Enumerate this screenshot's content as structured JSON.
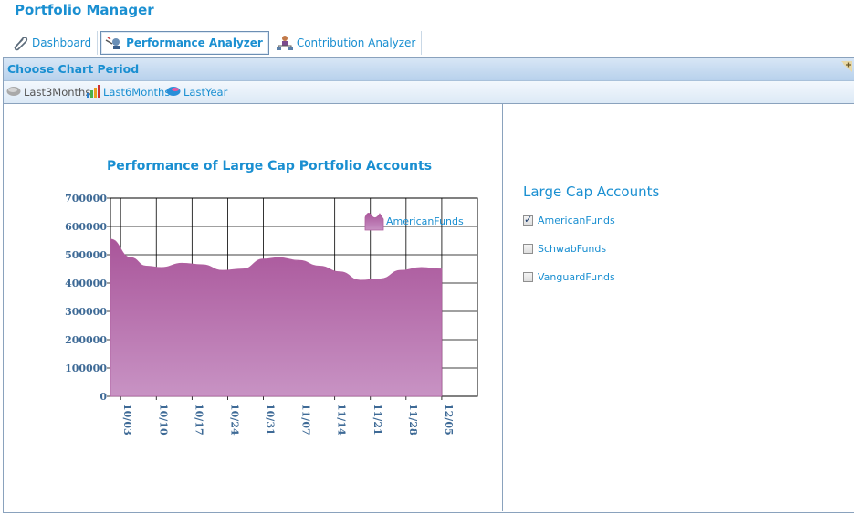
{
  "app": {
    "title": "Portfolio Manager"
  },
  "tabs": [
    {
      "label": "Dashboard",
      "icon": "paperclip-icon",
      "active": false
    },
    {
      "label": "Performance Analyzer",
      "icon": "analyzer-icon",
      "active": true
    },
    {
      "label": "Contribution Analyzer",
      "icon": "org-chart-icon",
      "active": false
    }
  ],
  "panel": {
    "title": "Choose Chart Period"
  },
  "toolbar": [
    {
      "label": "Last3Months",
      "icon": "gray-pill-icon",
      "color": "#555555"
    },
    {
      "label": "Last6Months",
      "icon": "bar-chart-icon",
      "color": "#1a8fd1"
    },
    {
      "label": "LastYear",
      "icon": "blue-pill-icon",
      "color": "#1a8fd1"
    }
  ],
  "chart_data": {
    "type": "area",
    "title": "Performance of Large Cap Portfolio Accounts",
    "xlabel": "",
    "ylabel": "",
    "ylim": [
      0,
      700000
    ],
    "yticks": [
      0,
      100000,
      200000,
      300000,
      400000,
      500000,
      600000,
      700000
    ],
    "ytick_labels": [
      "0",
      "100000",
      "200000",
      "300000",
      "400000",
      "500000",
      "600000",
      "700000"
    ],
    "xtick_labels": [
      "10/03",
      "10/10",
      "10/17",
      "10/24",
      "10/31",
      "11/07",
      "11/14",
      "11/21",
      "11/28",
      "12/05"
    ],
    "grid": true,
    "legend": "top-right",
    "series": [
      {
        "name": "AmericanFunds",
        "color": "#b0609f",
        "x": [
          "10/01",
          "10/05",
          "10/08",
          "10/11",
          "10/15",
          "10/19",
          "10/23",
          "10/27",
          "10/31",
          "11/03",
          "11/07",
          "11/11",
          "11/15",
          "11/19",
          "11/23",
          "11/27",
          "12/01",
          "12/05"
        ],
        "values": [
          555000,
          490000,
          460000,
          455000,
          470000,
          465000,
          445000,
          450000,
          485000,
          490000,
          480000,
          460000,
          440000,
          410000,
          415000,
          445000,
          455000,
          450000
        ]
      }
    ]
  },
  "side": {
    "title": "Large Cap Accounts",
    "accounts": [
      {
        "label": "AmericanFunds",
        "checked": true
      },
      {
        "label": "SchwabFunds",
        "checked": false
      },
      {
        "label": "VanguardFunds",
        "checked": false
      }
    ]
  }
}
